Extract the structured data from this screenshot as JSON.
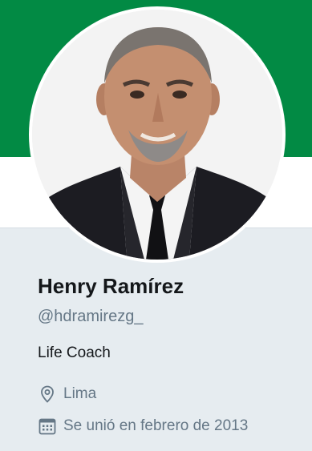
{
  "profile": {
    "name": "Henry Ramírez",
    "handle": "@hdramirezg_",
    "bio": "Life Coach",
    "location": "Lima",
    "joined": "Se unió en febrero de 2013"
  },
  "colors": {
    "banner": "#028a44",
    "background": "#e6ecf0",
    "text_primary": "#14171a",
    "text_secondary": "#657786"
  },
  "icons": {
    "location": "location-pin-icon",
    "joined": "calendar-icon"
  }
}
